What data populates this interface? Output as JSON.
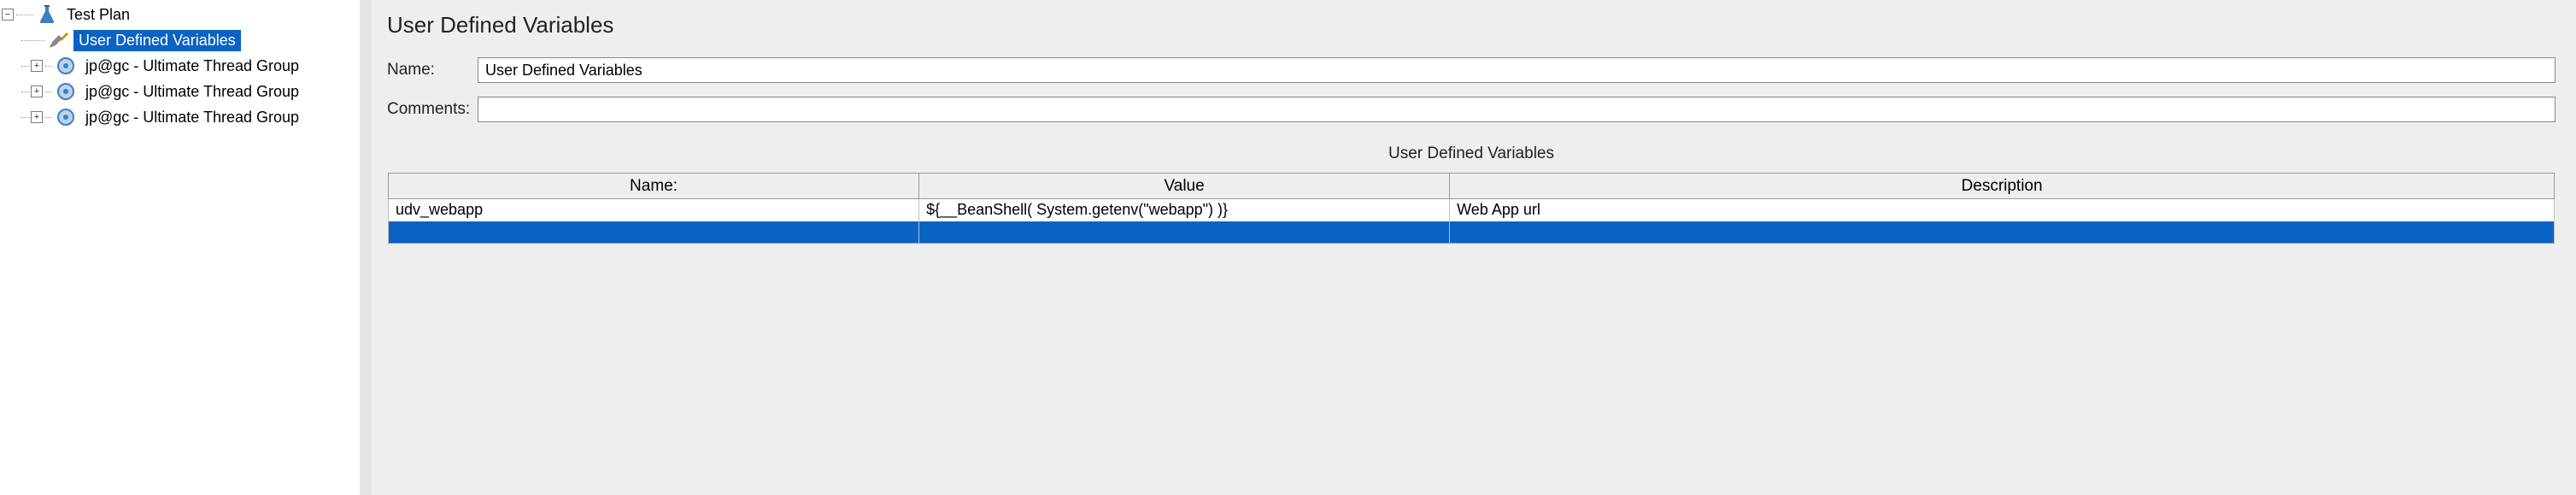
{
  "colors": {
    "selection": "#0a63c4"
  },
  "tree": {
    "root": {
      "label": "Test Plan",
      "expanded": true,
      "icon": "flask-icon"
    },
    "children": [
      {
        "label": "User Defined Variables",
        "icon": "tools-icon",
        "selected": true,
        "expandable": false
      },
      {
        "label": "jp@gc - Ultimate Thread Group",
        "icon": "gear-icon",
        "selected": false,
        "expandable": true
      },
      {
        "label": "jp@gc - Ultimate Thread Group",
        "icon": "gear-icon",
        "selected": false,
        "expandable": true
      },
      {
        "label": "jp@gc - Ultimate Thread Group",
        "icon": "gear-icon",
        "selected": false,
        "expandable": true
      }
    ]
  },
  "panel": {
    "title": "User Defined Variables",
    "name_label": "Name:",
    "name_value": "User Defined Variables",
    "comments_label": "Comments:",
    "comments_value": "",
    "table_title": "User Defined Variables",
    "columns": {
      "name": "Name:",
      "value": "Value",
      "description": "Description"
    },
    "rows": [
      {
        "name": "udv_webapp",
        "value": "${__BeanShell( System.getenv(\"webapp\") )}",
        "description": "Web App url"
      }
    ]
  }
}
